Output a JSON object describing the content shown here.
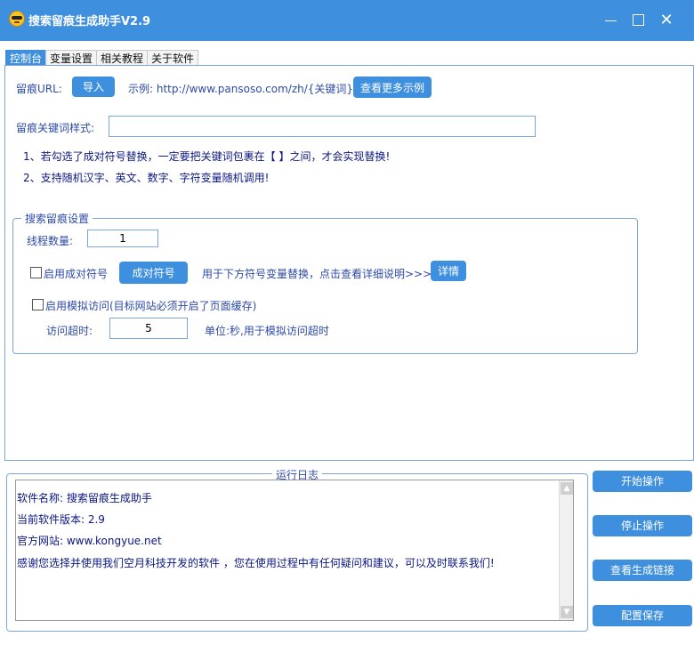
{
  "window": {
    "title": "搜索留痕生成助手V2.9",
    "controls": [
      "minimize",
      "maximize",
      "close"
    ]
  },
  "tabs": [
    {
      "label": "控制台",
      "active": true
    },
    {
      "label": "变量设置",
      "active": false
    },
    {
      "label": "相关教程",
      "active": false
    },
    {
      "label": "关于软件",
      "active": false
    }
  ],
  "console": {
    "url_label": "留痕URL:",
    "import_button": "导入",
    "example_text": "示例: http://www.pansoso.com/zh/{关键词}",
    "more_examples_button": "查看更多示例",
    "keyword_style_label": "留痕关键词样式:",
    "keyword_style_value": "",
    "notes": [
      "1、若勾选了成对符号替换，一定要把关键词包裹在【 】之间，才会实现替换!",
      "2、支持随机汉字、英文、数字、字符变量随机调用!"
    ],
    "settings": {
      "legend": "搜索留痕设置",
      "thread_label": "线程数量:",
      "thread_value": "1",
      "pair_checkbox_label": "启用成对符号",
      "pair_checked": false,
      "pair_button": "成对符号",
      "pair_hint": "用于下方符号变量替换，点击查看详细说明>>>",
      "detail_button": "详情",
      "simulate_checkbox_label": "启用模拟访问(目标网站必须开启了页面缓存)",
      "simulate_checked": false,
      "timeout_label": "访问超时:",
      "timeout_value": "5",
      "timeout_hint": "单位:秒,用于模拟访问超时"
    }
  },
  "log": {
    "legend": "运行日志",
    "lines": [
      "软件名称: 搜索留痕生成助手",
      "当前软件版本: 2.9",
      "官方网站: www.kongyue.net",
      "感谢您选择并使用我们空月科技开发的软件 ，您在使用过程中有任何疑问和建议，可以及时联系我们!"
    ]
  },
  "actions": {
    "start": "开始操作",
    "stop": "停止操作",
    "view_links": "查看生成链接",
    "save_config": "配置保存"
  },
  "colors": {
    "accent": "#3f8fdf",
    "label_text": "#2d4aa8",
    "note_text": "#0a1680",
    "border": "#7ba7d8"
  }
}
